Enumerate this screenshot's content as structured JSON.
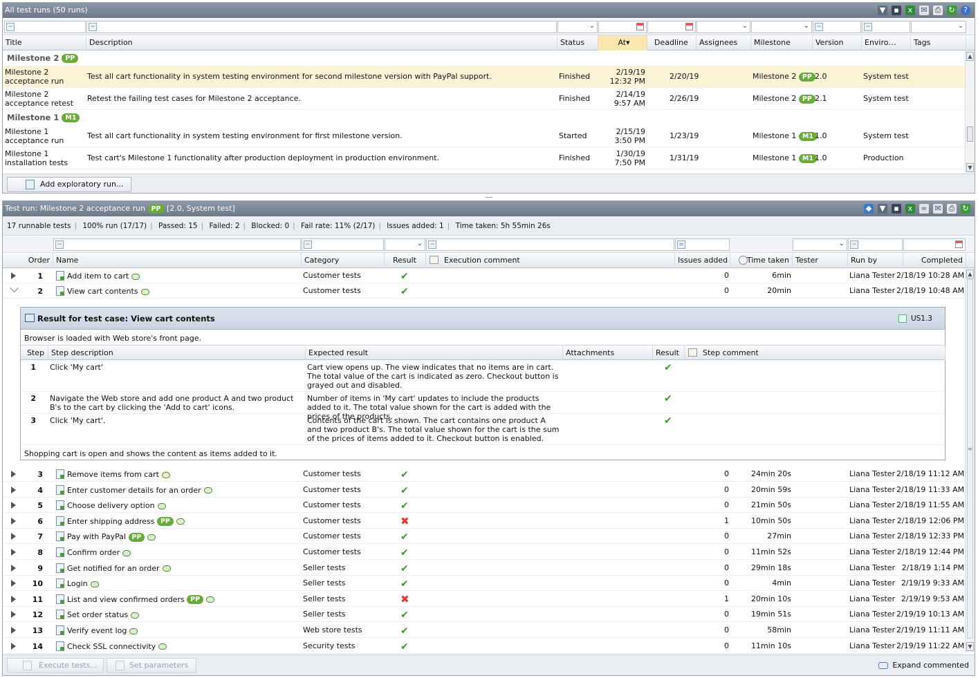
{
  "runs": {
    "title": "All test runs (50 runs)",
    "columns": [
      "Title",
      "Description",
      "Status",
      "At",
      "Deadline",
      "Assignees",
      "Milestone",
      "Version",
      "Enviro…",
      "Tags"
    ],
    "groups": [
      {
        "name": "Milestone 2",
        "badge": "PP",
        "rows": [
          {
            "title": "Milestone 2 acceptance run",
            "description": "Test all cart functionality in system testing environment for second milestone version with PayPal support.",
            "status": "Finished",
            "at": "2/19/19 12:32 PM",
            "deadline": "2/20/19",
            "milestone": "Milestone 2",
            "badge": "PP",
            "version": "2.0",
            "environment": "System test"
          },
          {
            "title": "Milestone 2 acceptance retest",
            "description": "Retest the failing test cases for Milestone 2 acceptance.",
            "status": "Finished",
            "at": "2/14/19 9:57 AM",
            "deadline": "2/26/19",
            "milestone": "Milestone 2",
            "badge": "PP",
            "version": "2.1",
            "environment": "System test"
          }
        ]
      },
      {
        "name": "Milestone 1",
        "badge": "M1",
        "rows": [
          {
            "title": "Milestone 1 acceptance run",
            "description": "Test all cart functionality in system testing environment for first milestone version.",
            "status": "Started",
            "at": "2/15/19 3:50 PM",
            "deadline": "1/23/19",
            "milestone": "Milestone 1",
            "badge": "M1",
            "version": "1.0",
            "environment": "System test"
          },
          {
            "title": "Milestone 1 installation tests",
            "description": "Test cart's Milestone 1 functionality after production deployment in production environment.",
            "status": "Finished",
            "at": "1/30/19 7:50 PM",
            "deadline": "1/31/19",
            "milestone": "Milestone 1",
            "badge": "M1",
            "version": "1.0",
            "environment": "Production"
          }
        ]
      }
    ],
    "add_button": "Add exploratory run..."
  },
  "run": {
    "title_prefix": "Test run: Milestone 2 acceptance run",
    "badge": "PP",
    "title_suffix": "[2.0, System test]",
    "stats": [
      "17 runnable tests",
      "100% run (17/17)",
      "Passed: 15",
      "Failed: 2",
      "Blocked: 0",
      "Fail rate: 11% (2/17)",
      "Issues added: 1",
      "Time taken: 5h 55min 26s"
    ],
    "columns": [
      "Order",
      "Name",
      "Category",
      "Result",
      "Execution comment",
      "Issues added",
      "Time taken",
      "Tester",
      "Run by",
      "Completed"
    ],
    "rows": [
      {
        "order": "1",
        "name": "Add item to cart",
        "category": "Customer tests",
        "result": "pass",
        "issues": "0",
        "time": "6min",
        "run_by": "Liana Tester",
        "completed": "2/18/19 10:28 AM"
      },
      {
        "order": "2",
        "name": "View cart contents",
        "category": "Customer tests",
        "result": "pass",
        "issues": "0",
        "time": "20min",
        "run_by": "Liana Tester",
        "completed": "2/18/19 10:48 AM"
      },
      {
        "order": "3",
        "name": "Remove items from cart",
        "category": "Customer tests",
        "result": "pass",
        "issues": "0",
        "time": "24min 20s",
        "run_by": "Liana Tester",
        "completed": "2/18/19 11:12 AM"
      },
      {
        "order": "4",
        "name": "Enter customer details for an order",
        "category": "Customer tests",
        "result": "pass",
        "issues": "0",
        "time": "20min 59s",
        "run_by": "Liana Tester",
        "completed": "2/18/19 11:33 AM"
      },
      {
        "order": "5",
        "name": "Choose delivery option",
        "category": "Customer tests",
        "result": "pass",
        "issues": "0",
        "time": "21min 50s",
        "run_by": "Liana Tester",
        "completed": "2/18/19 11:55 AM"
      },
      {
        "order": "6",
        "name": "Enter shipping address",
        "badge": "PP",
        "category": "Customer tests",
        "result": "fail",
        "issues": "1",
        "time": "10min 50s",
        "run_by": "Liana Tester",
        "completed": "2/18/19 12:06 PM"
      },
      {
        "order": "7",
        "name": "Pay with PayPal",
        "badge": "PP",
        "category": "Customer tests",
        "result": "pass",
        "issues": "0",
        "time": "27min",
        "run_by": "Liana Tester",
        "completed": "2/18/19 12:33 PM"
      },
      {
        "order": "8",
        "name": "Confirm order",
        "category": "Customer tests",
        "result": "pass",
        "issues": "0",
        "time": "11min 52s",
        "run_by": "Liana Tester",
        "completed": "2/18/19 12:44 PM"
      },
      {
        "order": "9",
        "name": "Get notified for an order",
        "category": "Seller tests",
        "result": "pass",
        "issues": "0",
        "time": "29min 18s",
        "run_by": "Liana Tester",
        "completed": "2/18/19 1:14 PM"
      },
      {
        "order": "10",
        "name": "Login",
        "category": "Seller tests",
        "result": "pass",
        "issues": "0",
        "time": "4min",
        "run_by": "Liana Tester",
        "completed": "2/19/19 9:33 AM"
      },
      {
        "order": "11",
        "name": "List and view confirmed orders",
        "badge": "PP",
        "category": "Seller tests",
        "result": "fail",
        "issues": "1",
        "time": "20min 10s",
        "run_by": "Liana Tester",
        "completed": "2/19/19 9:53 AM"
      },
      {
        "order": "12",
        "name": "Set order status",
        "category": "Seller tests",
        "result": "pass",
        "issues": "0",
        "time": "19min 51s",
        "run_by": "Liana Tester",
        "completed": "2/19/19 10:13 AM"
      },
      {
        "order": "13",
        "name": "Verify event log",
        "category": "Web store tests",
        "result": "pass",
        "issues": "0",
        "time": "58min",
        "run_by": "Liana Tester",
        "completed": "2/19/19 11:11 AM"
      },
      {
        "order": "14",
        "name": "Check SSL connectivity",
        "category": "Security tests",
        "result": "pass",
        "issues": "0",
        "time": "11min 10s",
        "run_by": "Liana Tester",
        "completed": "2/19/19 11:22 AM"
      }
    ],
    "detail": {
      "title": "Result for test case: View cart contents",
      "ref": "US1.3",
      "precondition": "Browser is loaded with Web store's front page.",
      "columns": [
        "Step",
        "Step description",
        "Expected result",
        "Attachments",
        "Result",
        "Step comment"
      ],
      "steps": [
        {
          "step": "1",
          "description": "Click 'My cart'",
          "expected": "Cart view opens up. The view indicates that no items are in cart. The total value of the cart is indicated as zero. Checkout button is grayed out and disabled.",
          "result": "pass"
        },
        {
          "step": "2",
          "description": "Navigate the Web store and add one product A and two product B's to the cart by clicking the 'Add to cart' icons.",
          "expected": "Number of items in 'My cart' updates to include the products added to it. The total value shown for the cart is added with the prices of the products.",
          "result": "pass"
        },
        {
          "step": "3",
          "description": "Click 'My cart'.",
          "expected": "Contents of the cart is shown. The cart contains one product A and two product B's. The total value shown for the cart is the sum of the prices of items added to it. Checkout button is enabled.",
          "result": "pass"
        }
      ],
      "postcondition": "Shopping cart is open and shows the content as items added to it."
    },
    "buttons": {
      "execute": "Execute tests...",
      "params": "Set parameters ...",
      "expand": "Expand commented"
    }
  },
  "colors": {
    "accent": "#6aab3c",
    "selected_row": "#fdf3d6",
    "title_bar": "#7b8795"
  }
}
